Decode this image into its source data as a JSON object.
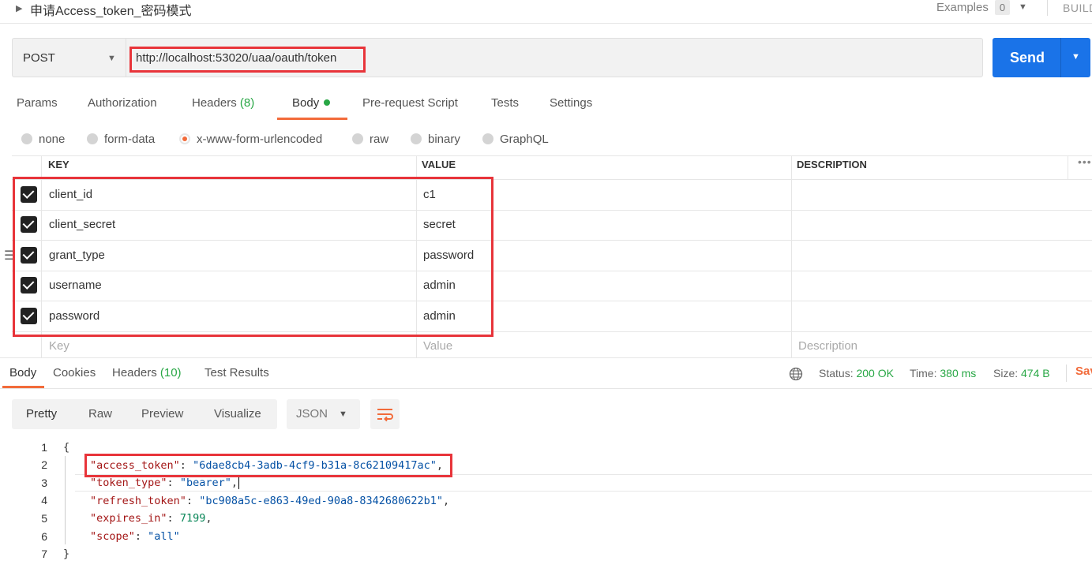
{
  "request": {
    "title": "申请Access_token_密码模式",
    "examples_label": "Examples",
    "examples_count": "0",
    "build_label": "BUILD",
    "method": "POST",
    "url": "http://localhost:53020/uaa/oauth/token",
    "send_label": "Send"
  },
  "request_tabs": [
    {
      "label": "Params"
    },
    {
      "label": "Authorization"
    },
    {
      "label": "Headers",
      "count": "(8)"
    },
    {
      "label": "Body"
    },
    {
      "label": "Pre-request Script"
    },
    {
      "label": "Tests"
    },
    {
      "label": "Settings"
    }
  ],
  "body_types": [
    "none",
    "form-data",
    "x-www-form-urlencoded",
    "raw",
    "binary",
    "GraphQL"
  ],
  "body_type_selected": "x-www-form-urlencoded",
  "table": {
    "headers": {
      "key": "KEY",
      "value": "VALUE",
      "description": "DESCRIPTION"
    },
    "more": "•••",
    "rows": [
      {
        "key": "client_id",
        "value": "c1"
      },
      {
        "key": "client_secret",
        "value": "secret"
      },
      {
        "key": "grant_type",
        "value": "password"
      },
      {
        "key": "username",
        "value": "admin"
      },
      {
        "key": "password",
        "value": "admin"
      }
    ],
    "placeholders": {
      "key": "Key",
      "value": "Value",
      "description": "Description"
    }
  },
  "response_tabs": [
    {
      "label": "Body"
    },
    {
      "label": "Cookies"
    },
    {
      "label": "Headers",
      "count": "(10)"
    },
    {
      "label": "Test Results"
    }
  ],
  "response_status": {
    "status_label": "Status:",
    "status_value": "200 OK",
    "time_label": "Time:",
    "time_value": "380 ms",
    "size_label": "Size:",
    "size_value": "474 B",
    "save_label": "Sav"
  },
  "view_modes": [
    "Pretty",
    "Raw",
    "Preview",
    "Visualize"
  ],
  "format": "JSON",
  "code": {
    "line_numbers": [
      "1",
      "2",
      "3",
      "4",
      "5",
      "6",
      "7"
    ],
    "open_brace": "{",
    "close_brace": "}",
    "access_token_key": "\"access_token\"",
    "access_token_value": "\"6dae8cb4-3adb-4cf9-b31a-8c62109417ac\"",
    "token_type_key": "\"token_type\"",
    "token_type_value": "\"bearer\"",
    "refresh_token_key": "\"refresh_token\"",
    "refresh_token_value": "\"bc908a5c-e863-49ed-90a8-8342680622b1\"",
    "expires_in_key": "\"expires_in\"",
    "expires_in_value": "7199",
    "scope_key": "\"scope\"",
    "scope_value": "\"all\""
  },
  "colors": {
    "accent": "#f26b3a",
    "send": "#1a73e8",
    "success": "#28a745",
    "highlight_box": "#e8343a"
  }
}
